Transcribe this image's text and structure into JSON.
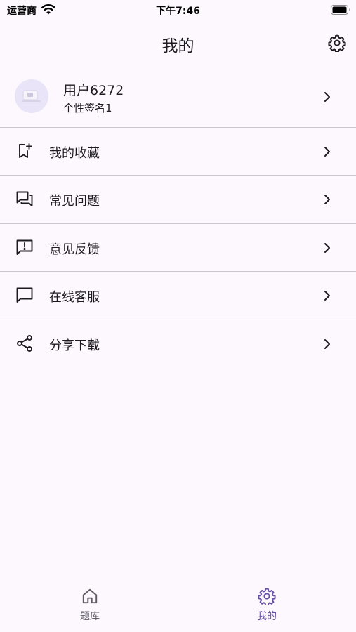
{
  "status_bar": {
    "carrier": "运营商",
    "time": "下午7:46"
  },
  "header": {
    "title": "我的",
    "settings_icon": "gear-icon"
  },
  "profile": {
    "username": "用户6272",
    "signature": "个性签名1",
    "avatar_icon": "avatar-placeholder-icon"
  },
  "menu": [
    {
      "label": "我的收藏",
      "icon": "bookmark-add-icon"
    },
    {
      "label": "常见问题",
      "icon": "forum-icon"
    },
    {
      "label": "意见反馈",
      "icon": "feedback-icon"
    },
    {
      "label": "在线客服",
      "icon": "chat-bubble-icon"
    },
    {
      "label": "分享下载",
      "icon": "share-icon"
    }
  ],
  "bottom_nav": [
    {
      "label": "题库",
      "icon": "home-icon",
      "active": false
    },
    {
      "label": "我的",
      "icon": "gear-icon",
      "active": true
    }
  ],
  "colors": {
    "background": "#fdf8fd",
    "accent": "#6750a4",
    "divider": "#cbc6cf",
    "text": "#1d1b20",
    "inactive": "#5f5b66"
  }
}
